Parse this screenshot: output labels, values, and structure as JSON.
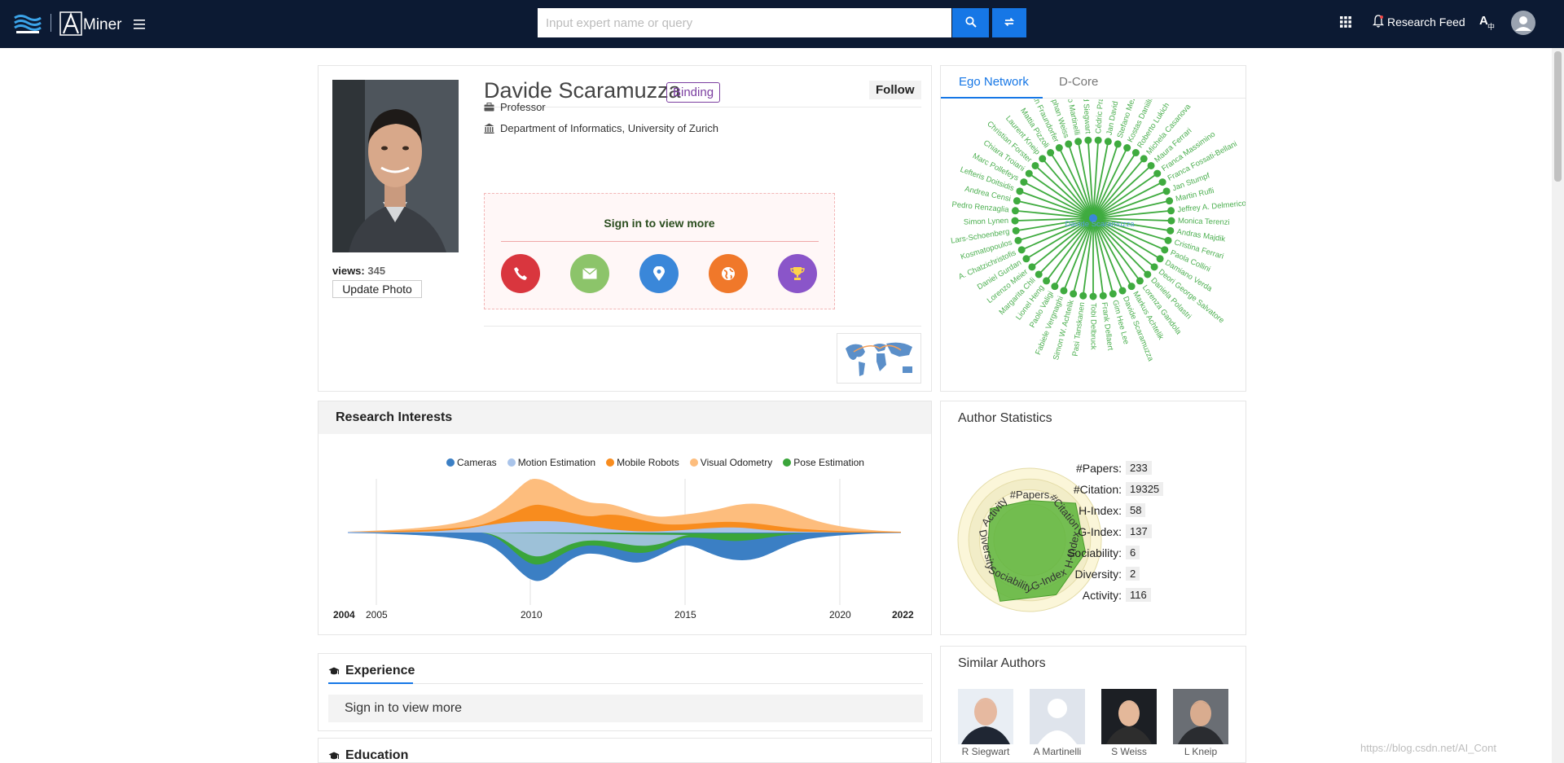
{
  "header": {
    "logo_text": "Miner",
    "search_placeholder": "Input expert name or query",
    "feed_label": "Research Feed"
  },
  "profile": {
    "name": "Davide Scaramuzza",
    "binding_label": "Binding",
    "follow_label": "Follow",
    "title": "Professor",
    "affiliation": "Department of Informatics, University of Zurich",
    "views_label": "views:",
    "views_count": "345",
    "update_photo_label": "Update Photo",
    "signin_prompt": "Sign in to view more",
    "contact_icons": [
      "phone-icon",
      "email-icon",
      "location-icon",
      "globe-icon",
      "trophy-icon"
    ],
    "contact_colors": [
      "#d9363e",
      "#8cc46a",
      "#3a87d9",
      "#f0782a",
      "#8a55c9"
    ]
  },
  "ego_network": {
    "tabs": [
      "Ego Network",
      "D-Core"
    ],
    "center": "Davide Scaramuzza",
    "nodes": [
      "Cédric Pradal",
      "Jan David Re",
      "Stefano Mezz",
      "Kostas Daniilidis",
      "Roberto Lukich",
      "Michela Casanova",
      "Maura Ferrari",
      "Franca Massimino",
      "Franca Fossati-Bellani",
      "Jan Stumpf",
      "Martin Rufli",
      "Jeffrey A. Delmerico",
      "Monica Terenzi",
      "Andras Majdik",
      "Cristina Ferrari",
      "Paola Collini",
      "Damiano Verda",
      "Deori George Salvatore",
      "Daniela Polastri",
      "Lorenza Gandola",
      "Markus Achtelik",
      "Davide Scaramuzza",
      "Gim Hee Lee",
      "Frank Dellaert",
      "Tobi Delbruck",
      "Pasi Tanskanen",
      "Simon W. Achtelik",
      "Fabiele Vergnaghi",
      "Paolo Valigi",
      "Lionel Heng",
      "Margarita Chli",
      "Lorenzo Meier",
      "Daniel Gurdan",
      "A. Chatzichristofis",
      "Kosmatopoulos",
      "Lars-Schoenberg",
      "Simon Lynen",
      "Pedro Renzaglia",
      "Andrea Censi",
      "Lefteris Doitsidis",
      "Marc Pollefeys",
      "Chiara Troiani",
      "Christian Forster",
      "Laurent Kneip",
      "Mattia Pizzoli",
      "Friedrich Fraundorfer",
      "Stephan Weiss",
      "Agostino Martinelli",
      "Roland Siegwart"
    ]
  },
  "research_interests": {
    "title": "Research Interests",
    "legend": [
      {
        "label": "Cameras",
        "color": "#3b7fc4"
      },
      {
        "label": "Motion Estimation",
        "color": "#a9c4ea"
      },
      {
        "label": "Mobile Robots",
        "color": "#f88c1e"
      },
      {
        "label": "Visual Odometry",
        "color": "#fdbd7d"
      },
      {
        "label": "Pose Estimation",
        "color": "#3aa53a"
      }
    ],
    "years_bold": [
      "2004",
      "2022"
    ],
    "years": [
      "2005",
      "2010",
      "2015",
      "2020"
    ]
  },
  "author_stats": {
    "title": "Author Statistics",
    "rows": [
      {
        "label": "#Papers:",
        "value": "233"
      },
      {
        "label": "#Citation:",
        "value": "19325"
      },
      {
        "label": "H-Index:",
        "value": "58"
      },
      {
        "label": "G-Index:",
        "value": "137"
      },
      {
        "label": "Sociability:",
        "value": "6"
      },
      {
        "label": "Diversity:",
        "value": "2"
      },
      {
        "label": "Activity:",
        "value": "116"
      }
    ],
    "radar_axes": [
      "#Papers",
      "#Citation",
      "H-Index",
      "G-Index",
      "Sociability",
      "Diversity",
      "Activity"
    ]
  },
  "experience": {
    "title": "Experience",
    "signin": "Sign in to view more"
  },
  "education": {
    "title": "Education"
  },
  "similar_authors": {
    "title": "Similar Authors",
    "people": [
      "R Siegwart",
      "A Martinelli",
      "S Weiss",
      "L Kneip"
    ]
  },
  "watermark": "https://blog.csdn.net/AI_Cont"
}
